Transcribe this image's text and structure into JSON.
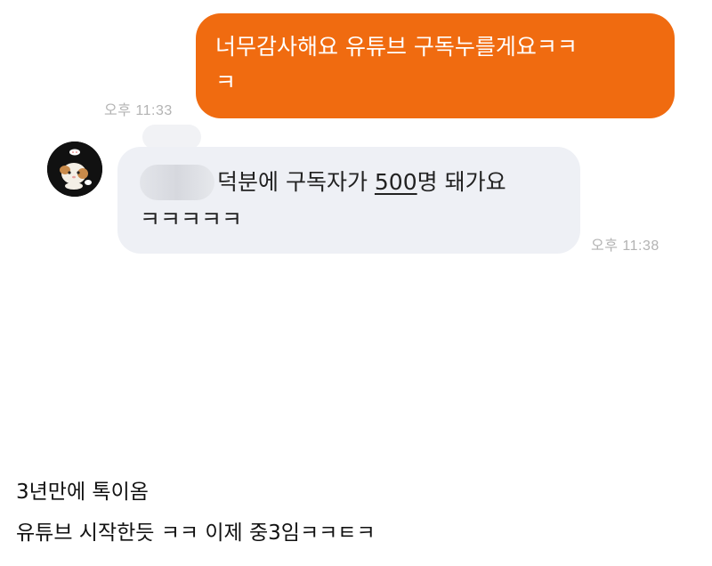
{
  "chat": {
    "sent_message": {
      "text": "너무감사해요 유튜브 구독누를게요ㅋㅋ\nㅋ",
      "time": "오후 11:33",
      "bubble_color": "#f06b10"
    },
    "received_message": {
      "text_before_number": "덕분에 구독자가 ",
      "number": "500",
      "text_after_number": "명 돼가요",
      "line2": "ㅋㅋㅋㅋㅋ",
      "time": "오후 11:38",
      "bubble_color": "#eef0f5"
    }
  },
  "caption": {
    "line1": "3년만에 톡이옴",
    "line2": "유튜브 시작한듯 ㅋㅋ 이제 중3임ㅋㅋㅌㅋ"
  }
}
